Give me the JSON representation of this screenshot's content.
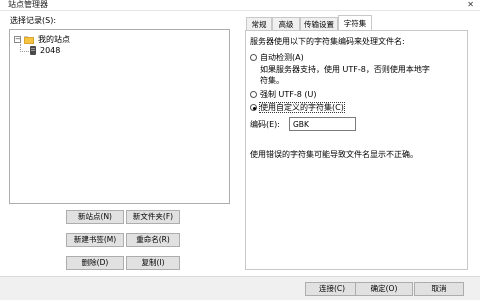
{
  "window": {
    "title": "站点管理器",
    "close_symbol": "✕"
  },
  "left": {
    "label": "选择记录(S):",
    "tree": {
      "root_toggle": "−",
      "root_label": "我的站点",
      "child_label": "2048"
    },
    "buttons": {
      "new_site": "新站点(N)",
      "new_folder": "新文件夹(F)",
      "new_bookmark": "新建书签(M)",
      "rename": "重命名(R)",
      "delete": "删除(D)",
      "copy": "复制(I)"
    }
  },
  "tabs": [
    {
      "label": "常规"
    },
    {
      "label": "高级"
    },
    {
      "label": "传输设置"
    },
    {
      "label": "字符集",
      "active": true
    }
  ],
  "charset": {
    "intro": "服务器使用以下的字符集编码来处理文件名:",
    "auto_detect": "自动检测(A)",
    "auto_desc_line1": "如果服务器支持，使用 UTF-8，否则使用本地字",
    "auto_desc_line2": "符集。",
    "force_utf8": "强制 UTF-8 (U)",
    "custom": "使用自定义的字符集(C)",
    "encoding_label": "编码(E):",
    "encoding_value": "GBK",
    "warning": "使用错误的字符集可能导致文件名显示不正确。",
    "selected_option": "custom"
  },
  "footer": {
    "connect": "连接(C)",
    "ok": "确定(O)",
    "cancel": "取消"
  }
}
